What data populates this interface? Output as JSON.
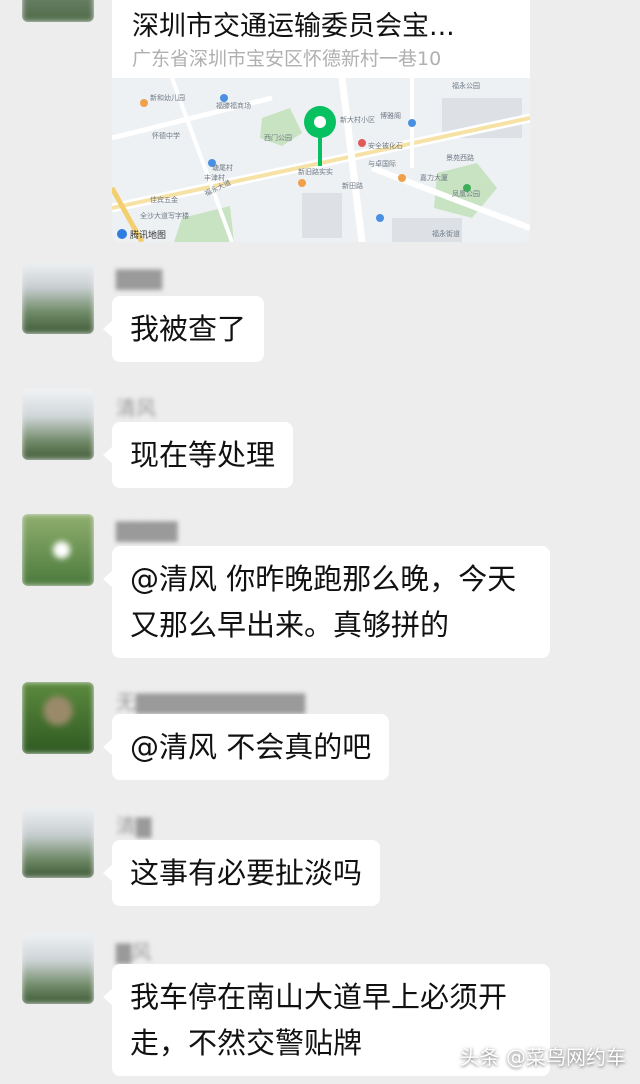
{
  "location": {
    "title": "深圳市交通运输委员会宝...",
    "address": "广东省深圳市宝安区怀德新村一巷10",
    "map_provider": "腾讯地图",
    "pin_color": "#07c160",
    "labels": [
      "新和幼儿园",
      "福滕福商场",
      "西门公园",
      "新大村小区",
      "博雅阁",
      "安全被化石",
      "福永大道",
      "新田路",
      "怀德中学",
      "塘尾村",
      "丰津村",
      "佳宾五金",
      "全沙大道写字楼",
      "凤凰公园",
      "福永街道",
      "景苑西路",
      "嘉力大厦",
      "福永公园",
      "与卓国际",
      "新旧路实实"
    ]
  },
  "messages": [
    {
      "sender": "▇▇▇",
      "text": "我被查了",
      "avatar": "landscape"
    },
    {
      "sender": "清风",
      "text": "现在等处理",
      "avatar": "landscape"
    },
    {
      "sender": "▇▇▇▇",
      "text": "@清风  你昨晚跑那么晚，今天又那么早出来。真够拼的",
      "avatar": "white-bird"
    },
    {
      "sender": "无▇▇▇▇▇▇▇▇▇▇▇",
      "text": "@清风  不会真的吧",
      "avatar": "green-plant"
    },
    {
      "sender": "清▇",
      "text": "这事有必要扯淡吗",
      "avatar": "landscape"
    },
    {
      "sender": "▇风",
      "text": "我车停在南山大道早上必须开走，不然交警贴牌",
      "avatar": "landscape"
    }
  ],
  "watermark": "头条 @菜鸟网约车",
  "colors": {
    "background": "#ededed",
    "bubble": "#ffffff"
  }
}
